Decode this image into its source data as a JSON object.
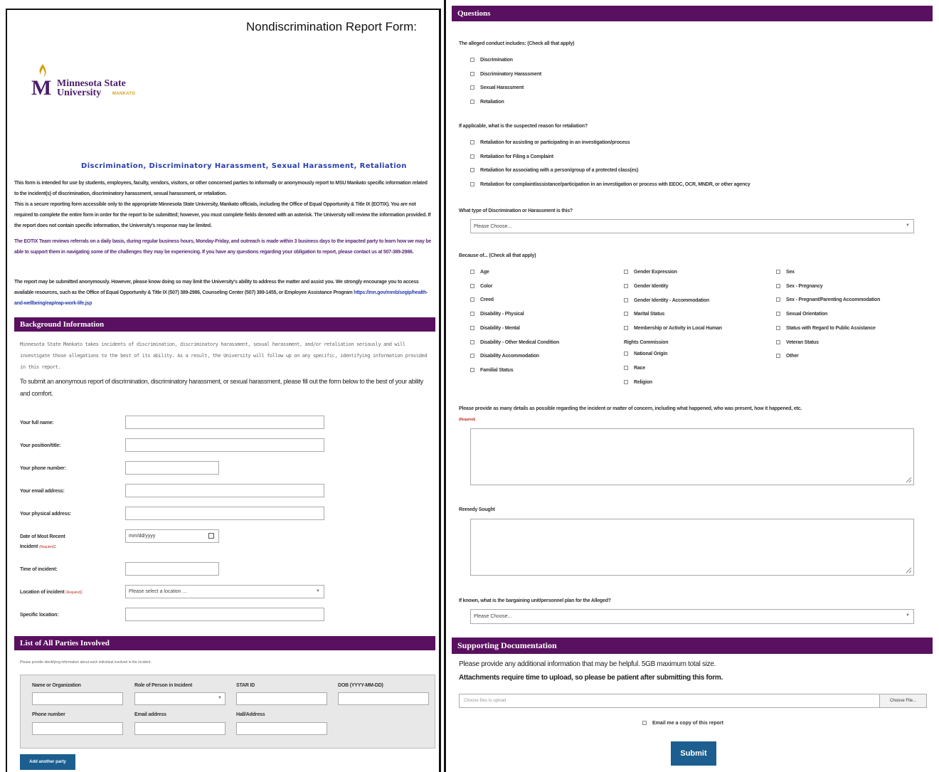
{
  "form": {
    "title": "Nondiscrimination Report Form:",
    "subtitle": "Discrimination, Discriminatory Harassment, Sexual Harassment, Retaliation"
  },
  "logo": {
    "letter": "M",
    "name_line1": "Minnesota State",
    "name_line2": "University",
    "tagline": "MANKATO"
  },
  "intro": {
    "p1": "This form is intended for use by students, employees, faculty, vendors, visitors, or other concerned parties to informally or anonymously report to MSU Mankato specific information related to the incident(s) of discrimination, discriminatory harassment, sexual harassment, or retaliation.",
    "p2": "This is a secure reporting form accessible only to the appropriate Minnesota State University, Mankato officials, including the Office of Equal Opportunity & Title IX (EOTIX). You are not required to complete the entire form in order for the report to be submitted; however, you must complete fields denoted with an asterisk. The University will review the information provided.  If the report does not contain specific information, the University's response may be limited.",
    "p3": "The EOTIX Team reviews referrals on a daily basis, during regular business hours, Monday-Friday, and outreach is made within 3 business days to the impacted party to learn how we may be able to support them in navigating some of the challenges they may be experiencing.  If you have any questions regarding your obligation to report, please contact us at 507-389-2986.",
    "p4": "The report may be submitted anonymously. However, please know doing so may limit the University's ability to address the matter and assist you. We strongly encourage you to access available resources, such as the Office of Equal Opportunity & Title IX (507) 389-2986, Counseling Center (507) 389-1455, or Employee Assistance Program",
    "p4_link": "https://mn.gov/mmb/segip/health-and-wellbeing/eap/eap-work-life.jsp"
  },
  "background": {
    "header": "Background Information",
    "description": "Minnesota State Mankato takes incidents of discrimination, discriminatory harassment, sexual harassment, and/or retaliation seriously and will investigate those allegations to the best of its ability. As a result, the University will follow up on any specific, identifying information provided in this report.",
    "instruction": "To submit an anonymous report of discrimination, discriminatory harassment, or sexual harassment, please fill out the form below to the best of your ability and comfort.",
    "required_tag": "(Required)",
    "fields": {
      "full_name": "Your full name:",
      "position": "Your position/title:",
      "phone": "Your phone number:",
      "email": "Your email address:",
      "address": "Your physical address:",
      "date_line1": "Date of Most Recent",
      "date_line2": "Incident",
      "date_placeholder": "mm/dd/yyyy",
      "time": "Time of incident:",
      "location": "Location of incident",
      "location_colon": ":",
      "location_placeholder": "Please select a location ...",
      "specific_location": "Specific location:"
    }
  },
  "parties": {
    "header": "List of All Parties Involved",
    "note": "Please provide identifying information about each individual involved in the incident.",
    "labels": {
      "name": "Name or Organization",
      "role": "Role of Person in Incident",
      "star_id": "STAR ID",
      "dob": "DOB (YYYY-MM-DD)",
      "phone": "Phone number",
      "email": "Email address",
      "hall": "Hall/Address"
    },
    "add_button": "Add another party"
  },
  "questions": {
    "header": "Questions",
    "conduct_label": "The alleged conduct includes: (Check all that apply)",
    "conduct_options": [
      "Discrimination",
      "Discriminatory Harassment",
      "Sexual Harassment",
      "Retaliation"
    ],
    "retaliation_label": "If applicable, what is the suspected reason for retaliation?",
    "retaliation_options": [
      "Retaliation for assisting or participating in an investigation/process",
      "Retaliation for Filing a Complaint",
      "Retaliation for associating with a person/group of a protected class(es)",
      "Retaliation for complaint/assistance/participation in an investigation or process with EEOC, OCR, MNDR, or other agency"
    ],
    "type_label": "What type of Discrimination or Harassment is this?",
    "type_placeholder": "Please Choose...",
    "because_label": "Because of... (Check all that apply)",
    "because_col1": [
      "Age",
      "Color",
      "Creed",
      "Disability - Physical",
      "Disability - Mental",
      "Disability - Other Medical Condition",
      "Disability Accommodation",
      "Familial Status"
    ],
    "because_col2": [
      "Gender Expression",
      "Gender Identity",
      "Gender Identity - Accommodation",
      "Marital Status",
      "Membership or Activity in Local Human",
      "Rights Commission",
      "National Origin",
      "Race",
      "Religion"
    ],
    "because_col3": [
      "Sex",
      "Sex - Pregnancy",
      "Sex - Pregnant/Parenting Accommodation",
      "Sexual Orientation",
      "Status with Regard to Public Assistance",
      "Veteran Status",
      "Other"
    ],
    "details_label": "Please provide as many details as possible regarding the incident or matter of concern, including what happened, who was present, how it happened, etc.",
    "details_required": "(Required)",
    "remedy_label": "Remedy Sought",
    "unit_label": "If known, what is the bargaining unit/personnel plan for the Alleged?",
    "unit_placeholder": "Please Choose..."
  },
  "supporting": {
    "header": "Supporting Documentation",
    "text1": "Please provide any additional information that may be helpful. 5GB maximum total size.",
    "text2": "Attachments require time to upload, so please be patient after submitting this form.",
    "file_placeholder": "Choose files to upload",
    "file_button": "Choose File...",
    "email_copy": "Email me a copy of this report",
    "submit": "Submit"
  },
  "colors": {
    "section_bar": "#5a1060",
    "button_blue": "#1b5e8f",
    "subtitle_blue": "#2a3fae",
    "brand_gold": "#d4a017"
  }
}
